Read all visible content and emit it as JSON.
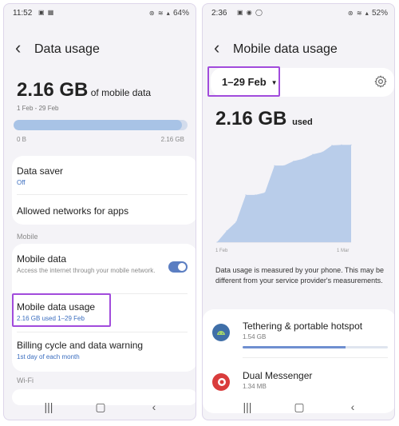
{
  "left": {
    "status": {
      "time": "11:52",
      "battery": "64%"
    },
    "header": {
      "title": "Data usage"
    },
    "summary": {
      "amount": "2.16 GB",
      "unit": " of mobile data",
      "range": "1 Feb - 29 Feb",
      "bar_min": "0 B",
      "bar_max": "2.16 GB",
      "fill_fraction": 0.97
    },
    "items": {
      "data_saver": {
        "title": "Data saver",
        "subtitle": "Off"
      },
      "allowed_networks": {
        "title": "Allowed networks for apps"
      },
      "section_mobile": "Mobile",
      "mobile_data": {
        "title": "Mobile data",
        "desc": "Access the internet through your mobile network.",
        "enabled": true
      },
      "mobile_data_usage": {
        "title": "Mobile data usage",
        "subtitle": "2.16 GB used 1–29 Feb"
      },
      "billing": {
        "title": "Billing cycle and data warning",
        "subtitle": "1st day of each month"
      },
      "section_wifi": "Wi-Fi"
    }
  },
  "right": {
    "status": {
      "time": "2:36",
      "battery": "52%"
    },
    "header": {
      "title": "Mobile data usage"
    },
    "period": "1–29 Feb",
    "used": {
      "amount": "2.16 GB",
      "unit": "used"
    },
    "chart_data": {
      "type": "area",
      "x": [
        "1 Feb",
        "4 Feb",
        "6 Feb",
        "7 Feb",
        "8 Feb",
        "14 Feb",
        "15 Feb",
        "17 Feb",
        "18 Feb",
        "21 Feb",
        "22 Feb",
        "24 Feb",
        "25 Feb",
        "29 Feb",
        "1 Mar"
      ],
      "values": [
        0,
        0.25,
        0.45,
        1.05,
        1.05,
        1.1,
        1.7,
        1.7,
        1.8,
        1.85,
        1.95,
        2.0,
        2.15,
        2.16,
        2.16
      ],
      "xlabel": "",
      "ylabel": "",
      "ylim": [
        0,
        2.2
      ],
      "x_labels": [
        "1 Feb",
        "1 Mar"
      ]
    },
    "note": "Data usage is measured by your phone. This may be different from your service provider's measurements.",
    "apps": [
      {
        "name": "Tethering & portable hotspot",
        "size": "1.54 GB",
        "fraction": 0.71,
        "icon": "android-icon",
        "color": "#3f6fa8"
      },
      {
        "name": "Dual Messenger",
        "size": "1.34 MB",
        "fraction": 0.0,
        "icon": "dual-messenger-icon",
        "color": "#d93c3c"
      }
    ]
  },
  "colors": {
    "highlight": "#a14bdc",
    "accent": "#5b7ec2",
    "chart_fill": "#b9cdea"
  }
}
